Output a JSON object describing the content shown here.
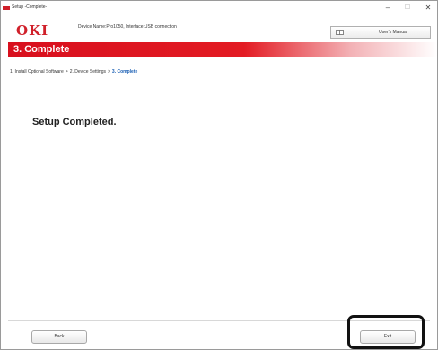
{
  "window": {
    "title": "Setup -Complete-",
    "minimize_glyph": "–",
    "maximize_glyph": "☐",
    "close_glyph": "✕"
  },
  "header": {
    "logo": "OKI",
    "device_info": "Device Name:Pro1050, Interface:USB connection",
    "manual_button": "User's Manual",
    "manual_icon": "book-icon"
  },
  "banner": {
    "title": "3. Complete"
  },
  "breadcrumb": {
    "steps": [
      "1. Install Optional Software",
      "2. Device Settings",
      "3. Complete"
    ],
    "separator": ">"
  },
  "main": {
    "message": "Setup Completed."
  },
  "footer": {
    "back_label": "Back",
    "exit_label": "Exit"
  },
  "colors": {
    "brand_red": "#d0202a",
    "banner_red": "#e31b23",
    "breadcrumb_active": "#1a5fb4"
  }
}
